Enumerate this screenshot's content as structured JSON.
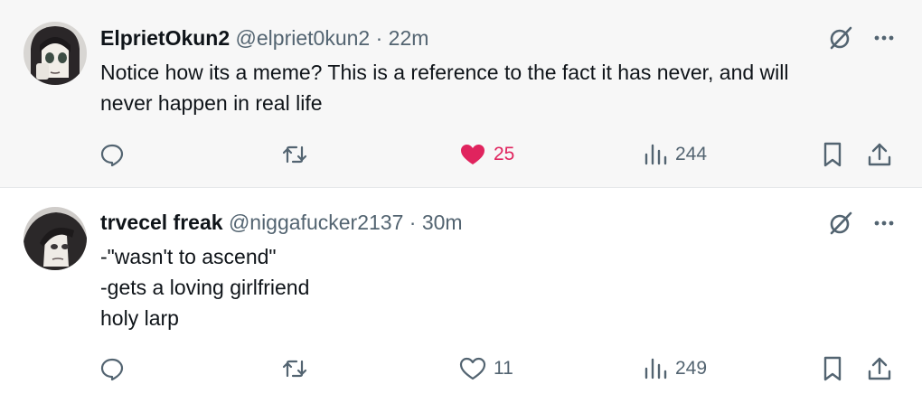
{
  "colors": {
    "like_active": "#e0245e",
    "secondary_text": "#536471",
    "primary_text": "#0f1419",
    "highlight_bg": "#f7f7f7"
  },
  "tweets": [
    {
      "display_name": "ElprietOkun2",
      "handle": "@elpriet0kun2",
      "separator": "·",
      "time": "22m",
      "body_lines": [
        "Notice how its a meme? This is a reference to the fact it has never, and will",
        "never happen in real life"
      ],
      "likes": "25",
      "liked": true,
      "views": "244",
      "icons": [
        "grok-icon",
        "more-icon",
        "reply-icon",
        "retweet-icon",
        "heart-filled-icon",
        "views-icon",
        "bookmark-icon",
        "share-icon"
      ]
    },
    {
      "display_name": "trvecel freak",
      "handle": "@niggafucker2137",
      "separator": "·",
      "time": "30m",
      "body_lines": [
        "-\"wasn't to ascend\"",
        "-gets a loving girlfriend",
        "holy larp"
      ],
      "likes": "11",
      "liked": false,
      "views": "249",
      "icons": [
        "grok-icon",
        "more-icon",
        "reply-icon",
        "retweet-icon",
        "heart-outline-icon",
        "views-icon",
        "bookmark-icon",
        "share-icon"
      ]
    }
  ]
}
